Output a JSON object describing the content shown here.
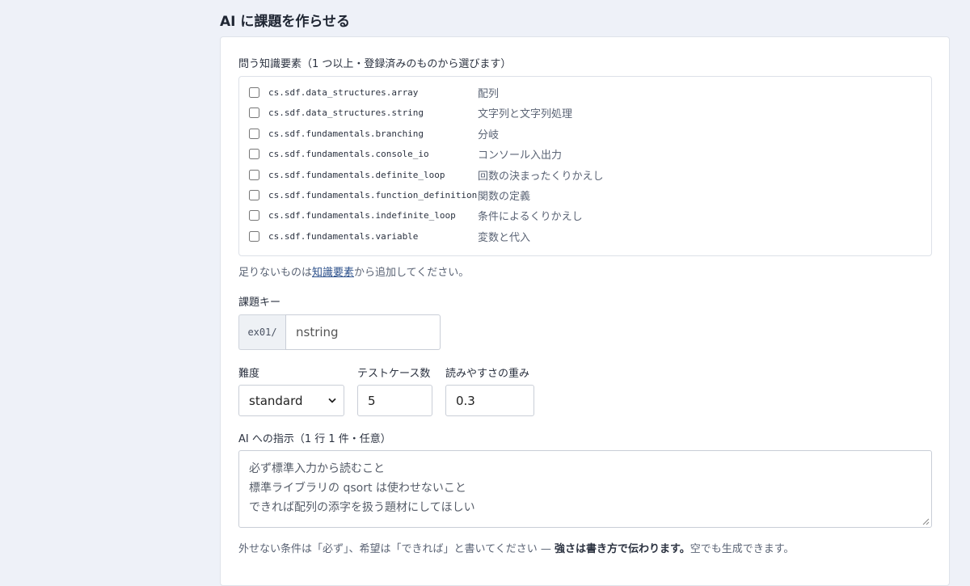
{
  "page_title": "AI に課題を作らせる",
  "knowledge": {
    "label": "問う知識要素（1 つ以上・登録済みのものから選びます）",
    "items": [
      {
        "key": "cs.sdf.data_structures.array",
        "label": "配列",
        "checked": false
      },
      {
        "key": "cs.sdf.data_structures.string",
        "label": "文字列と文字列処理",
        "checked": false
      },
      {
        "key": "cs.sdf.fundamentals.branching",
        "label": "分岐",
        "checked": false
      },
      {
        "key": "cs.sdf.fundamentals.console_io",
        "label": "コンソール入出力",
        "checked": false
      },
      {
        "key": "cs.sdf.fundamentals.definite_loop",
        "label": "回数の決まったくりかえし",
        "checked": false
      },
      {
        "key": "cs.sdf.fundamentals.function_definition",
        "label": "関数の定義",
        "checked": false
      },
      {
        "key": "cs.sdf.fundamentals.indefinite_loop",
        "label": "条件によるくりかえし",
        "checked": false
      },
      {
        "key": "cs.sdf.fundamentals.variable",
        "label": "変数と代入",
        "checked": false
      }
    ],
    "hint_before": "足りないものは",
    "hint_link": "知識要素",
    "hint_after": "から追加してください。"
  },
  "task_key": {
    "label": "課題キー",
    "prefix": "ex01/",
    "value": "nstring"
  },
  "difficulty": {
    "label": "難度",
    "value": "standard"
  },
  "test_cases": {
    "label": "テストケース数",
    "value": "5"
  },
  "readability": {
    "label": "読みやすさの重み",
    "value": "0.3"
  },
  "instructions": {
    "label": "AI への指示（1 行 1 件・任意）",
    "lines": [
      "必ず標準入力から読むこと",
      "標準ライブラリの qsort は使わせないこと",
      "できれば配列の添字を扱う題材にしてほしい"
    ],
    "hint_before": "外せない条件は「必ず」、希望は「できれば」と書いてください — ",
    "hint_strong": "強さは書き方で伝わります。",
    "hint_after": "空でも生成できます。"
  }
}
